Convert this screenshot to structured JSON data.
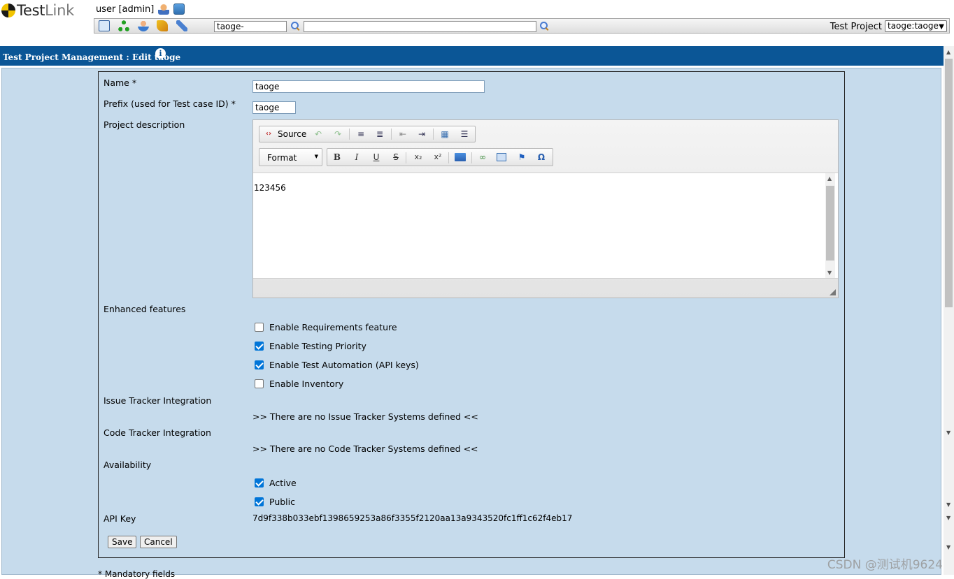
{
  "app": {
    "logo_text_a": "Test",
    "logo_text_b": "Link"
  },
  "header": {
    "user": "user [admin]",
    "search_value": "taoge-",
    "search2_value": "",
    "project_label": "Test Project",
    "project_selected": "taoge:taoge"
  },
  "title": "Test Project Management : Edit taoge",
  "form": {
    "name_label": "Name *",
    "name_value": "taoge",
    "prefix_label": "Prefix (used for Test case ID) *",
    "prefix_value": "taoge",
    "desc_label": "Project description",
    "editor": {
      "source_label": "Source",
      "format_label": "Format",
      "content": "123456"
    },
    "enhanced_label": "Enhanced features",
    "features": [
      {
        "label": "Enable Requirements feature",
        "checked": false
      },
      {
        "label": "Enable Testing Priority",
        "checked": true
      },
      {
        "label": "Enable Test Automation (API keys)",
        "checked": true
      },
      {
        "label": "Enable Inventory",
        "checked": false
      }
    ],
    "issue_label": "Issue Tracker Integration",
    "issue_text": ">> There are no Issue Tracker Systems defined <<",
    "code_label": "Code Tracker Integration",
    "code_text": ">> There are no Code Tracker Systems defined <<",
    "availability_label": "Availability",
    "availability": [
      {
        "label": "Active",
        "checked": true
      },
      {
        "label": "Public",
        "checked": true
      }
    ],
    "api_key_label": "API Key",
    "api_key": "7d9f338b033ebf1398659253a86f3355f2120aa13a9343520fc1ff1c62f4eb17",
    "save": "Save",
    "cancel": "Cancel"
  },
  "footnote": "* Mandatory fields",
  "watermark": "CSDN @测试机9624"
}
